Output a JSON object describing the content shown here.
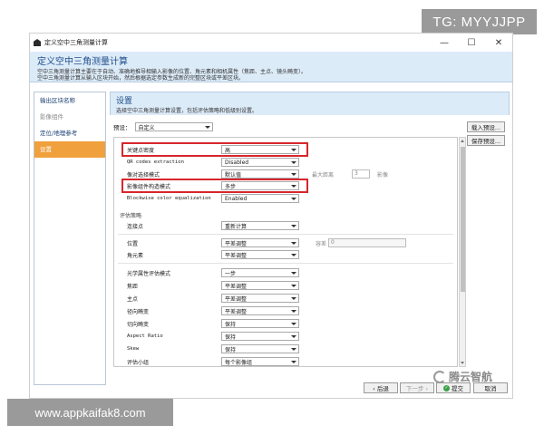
{
  "watermark": {
    "top": "TG: MYYJJPP",
    "bottom": "www.appkaifak8.com",
    "logo": "腾云智航"
  },
  "window": {
    "title": "定义空中三角测量计算",
    "min": "—",
    "max": "☐",
    "close": "✕"
  },
  "header": {
    "title": "定义空中三角测量计算",
    "desc1": "空中三角测量计算主要在于自动、准确地推导相输入影像的位置、角元素和相机属性（焦距、主点、镜头畸变）。",
    "desc2": "空中三角测量计算从输入区块开始，然后根据选定参数生成新的完整区块或平差区块。"
  },
  "sidebar": {
    "items": [
      {
        "label": "输出区块名称",
        "state": "normal"
      },
      {
        "label": "影像组件",
        "state": "disabled"
      },
      {
        "label": "定位/地理参考",
        "state": "normal"
      },
      {
        "label": "设置",
        "state": "active"
      }
    ]
  },
  "content": {
    "title": "设置",
    "subtitle": "选择空中三角测量计算设置，包括评估策略和低级别设置。",
    "preset_label": "预设：",
    "preset_value": "自定义",
    "load_preset": "载入预设...",
    "save_preset": "保存预设..."
  },
  "settings": [
    {
      "name": "关键点密度",
      "value": "高",
      "highlight": true
    },
    {
      "name": "QR codes extraction",
      "value": "Disabled",
      "mono": true
    },
    {
      "name": "像对选择模式",
      "value": "默认值",
      "extra_label": "最大距离",
      "extra_value": "3",
      "extra_unit": "影像"
    },
    {
      "name": "影像组件构造模式",
      "value": "多步",
      "highlight": true
    },
    {
      "name": "Blockwise color equalization",
      "value": "Enabled",
      "mono": true
    }
  ],
  "strategy": {
    "section": "评估策略",
    "tie_points": {
      "name": "连接点",
      "value": "重新计算"
    },
    "position": {
      "name": "位置",
      "value": "平差调整",
      "tol_label": "容差",
      "tol_value": "0"
    },
    "rotation": {
      "name": "角元素",
      "value": "平差调整"
    },
    "optical": [
      {
        "name": "光学属性评估模式",
        "value": "一步"
      },
      {
        "name": "焦距",
        "value": "平差调整"
      },
      {
        "name": "主点",
        "value": "平差调整"
      },
      {
        "name": "径向畸变",
        "value": "平差调整"
      },
      {
        "name": "切向畸变",
        "value": "保持"
      },
      {
        "name": "Aspect Ratio",
        "value": "保持",
        "mono": true
      },
      {
        "name": "Skew",
        "value": "保持",
        "mono": true
      },
      {
        "name": "评估小组",
        "value": "每个影像组"
      }
    ]
  },
  "footer": {
    "back": "‹ 后退",
    "next": "下一步 ›",
    "submit": "提交",
    "cancel": "取消"
  }
}
